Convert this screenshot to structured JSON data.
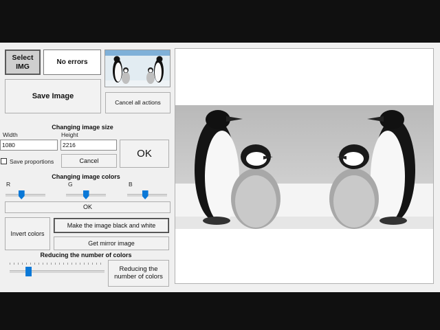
{
  "buttons": {
    "select_img": "Select IMG",
    "no_errors": "No errors",
    "save_image": "Save Image",
    "cancel_all": "Cancel all actions",
    "ok_size": "OK",
    "cancel_size": "Cancel",
    "ok_colors": "OK",
    "invert_colors": "Invert colors",
    "black_white": "Make the image black and white",
    "mirror": "Get mirror image",
    "reduce_colors": "Reducing the number of colors"
  },
  "size_section": {
    "title": "Changing image size",
    "width_label": "Width",
    "height_label": "Height",
    "width_value": "1080",
    "height_value": "2216",
    "save_proportions": "Save proportions",
    "save_proportions_checked": false
  },
  "colors_section": {
    "title": "Changing image colors",
    "r_label": "R",
    "g_label": "G",
    "b_label": "B",
    "r_level": 0.4,
    "g_level": 0.5,
    "b_level": 0.45
  },
  "reduce_section": {
    "title": "Reducing the number of colors",
    "level": 0.2
  },
  "colors": {
    "slider_accent": "#0a78d7",
    "window_bg": "#f0f0f0"
  }
}
